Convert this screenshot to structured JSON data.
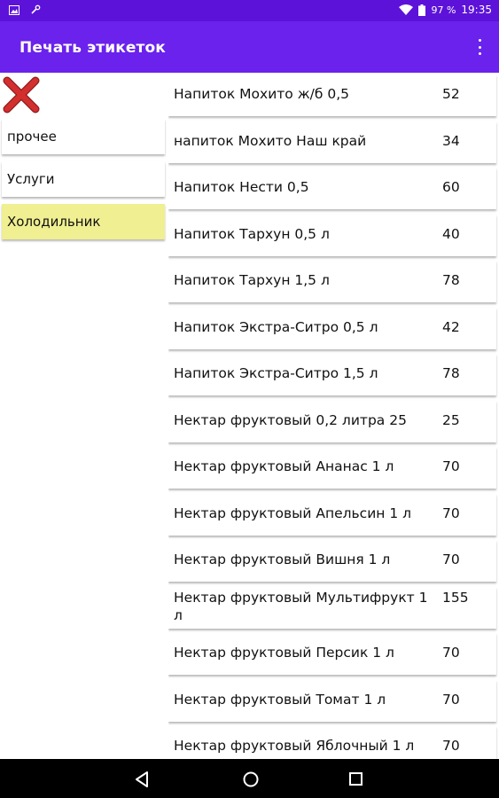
{
  "status_bar": {
    "battery_percent": "97 %",
    "time": "19:35"
  },
  "app_bar": {
    "title": "Печать этикеток"
  },
  "categories": [
    {
      "label": "прочее"
    },
    {
      "label": "Услуги"
    },
    {
      "label": "Холодильник"
    }
  ],
  "products": [
    {
      "name": "Напиток Мохито ж/б 0,5",
      "price": "52"
    },
    {
      "name": "напиток Мохито Наш край",
      "price": "34"
    },
    {
      "name": "Напиток Нести 0,5",
      "price": "60"
    },
    {
      "name": "Напиток Тархун 0,5 л",
      "price": "40"
    },
    {
      "name": "Напиток Тархун 1,5 л",
      "price": "78"
    },
    {
      "name": "Напиток Экстра-Ситро 0,5 л",
      "price": "42"
    },
    {
      "name": "Напиток Экстра-Ситро 1,5 л",
      "price": "78"
    },
    {
      "name": "Нектар фруктовый 0,2 литра 25",
      "price": "25"
    },
    {
      "name": "Нектар фруктовый Ананас 1 л",
      "price": "70"
    },
    {
      "name": "Нектар фруктовый Апельсин 1 л",
      "price": "70"
    },
    {
      "name": "Нектар фруктовый Вишня 1 л",
      "price": "70"
    },
    {
      "name": "Нектар фруктовый Мультифрукт 1 л",
      "price": "155"
    },
    {
      "name": "Нектар фруктовый Персик 1 л",
      "price": "70"
    },
    {
      "name": "Нектар фруктовый Томат 1 л",
      "price": "70"
    },
    {
      "name": "Нектар фруктовый Яблочный 1 л",
      "price": "70"
    }
  ],
  "colors": {
    "status_bar": "#5d12d9",
    "app_bar": "#6a22ec",
    "selected_category": "#f0ef91",
    "close_icon": "#d32f2f"
  },
  "icons": {
    "close": "close-icon",
    "menu": "more-vert-icon",
    "back": "back-icon",
    "home": "home-icon",
    "recents": "recents-icon"
  }
}
